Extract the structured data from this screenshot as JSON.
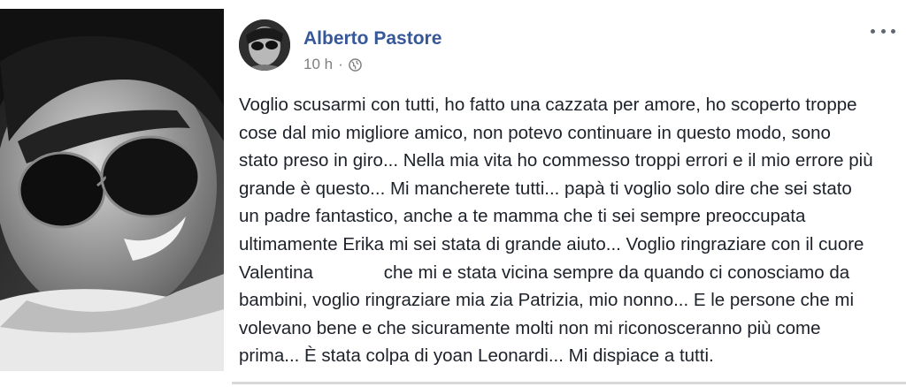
{
  "post": {
    "author": "Alberto Pastore",
    "time": "10 h",
    "separator": "·",
    "privacy_icon": "globe-icon",
    "more_icon": "more-options-icon",
    "lines": [
      "Voglio scusarmi con tutti, ho fatto una cazzata per amore, ho scoperto troppe",
      "cose dal mio migliore amico, non potevo continuare in questo modo, sono",
      "stato preso in giro... Nella mia vita ho commesso troppi errori e il mio errore più",
      "grande è questo... Mi mancherete tutti... papà ti voglio solo dire che sei stato",
      "un padre fantastico, anche a te mamma che ti sei sempre preoccupata",
      "ultimamente Erika mi sei stata di grande aiuto... Voglio ringraziare con il cuore",
      "Valentina              che mi e stata vicina sempre da quando ci conosciamo da",
      "bambini, voglio ringraziare mia zia Patrizia, mio nonno... E le persone che mi",
      "volevano bene e che sicuramente molti non mi riconosceranno più come",
      "prima... È stata colpa di yoan Leonardi... Mi dispiace a tutti."
    ]
  },
  "colors": {
    "author": "#365899",
    "meta": "#7f7f7f",
    "text": "#1d2129"
  }
}
